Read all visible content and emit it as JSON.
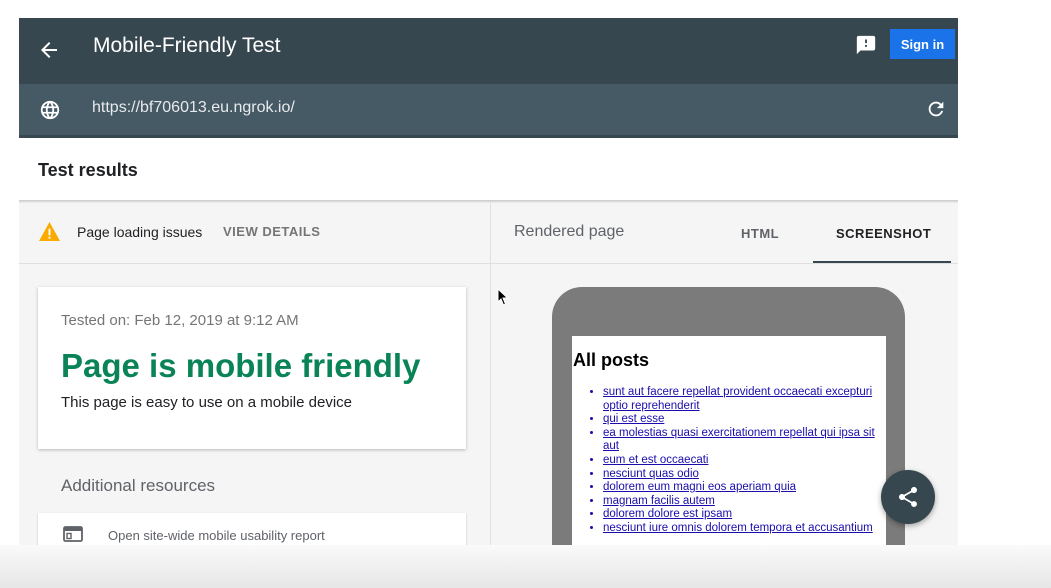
{
  "header": {
    "title": "Mobile-Friendly Test",
    "sign_in_label": "Sign in",
    "back_icon": "arrow-back-icon",
    "feedback_icon": "feedback-icon"
  },
  "url_bar": {
    "url": "https://bf706013.eu.ngrok.io/",
    "globe_icon": "globe-icon",
    "reload_icon": "reload-icon"
  },
  "results": {
    "heading": "Test results"
  },
  "issues": {
    "label": "Page loading issues",
    "view_details": "VIEW DETAILS",
    "icon": "warning-icon"
  },
  "verdict_card": {
    "tested_on": "Tested on: Feb 12, 2019 at 9:12 AM",
    "verdict": "Page is mobile friendly",
    "subtitle": "This page is easy to use on a mobile device"
  },
  "additional": {
    "heading": "Additional resources",
    "items": [
      {
        "label": "Open site-wide mobile usability report",
        "icon": "browser-window-icon"
      }
    ]
  },
  "right_panel": {
    "rendered_label": "Rendered page",
    "tabs": [
      {
        "label": "HTML",
        "selected": false
      },
      {
        "label": "SCREENSHOT",
        "selected": true
      }
    ]
  },
  "phone_preview": {
    "heading": "All posts",
    "posts": [
      "sunt aut facere repellat provident occaecati excepturi optio reprehenderit",
      "qui est esse",
      "ea molestias quasi exercitationem repellat qui ipsa sit aut",
      "eum et est occaecati",
      "nesciunt quas odio",
      "dolorem eum magni eos aperiam quia",
      "magnam facilis autem",
      "dolorem dolore est ipsam",
      "nesciunt iure omnis dolorem tempora et accusantium"
    ]
  },
  "fab": {
    "icon": "share-icon"
  },
  "colors": {
    "header_bg": "#37474f",
    "url_bar_bg": "#455a64",
    "sign_in_bg": "#1a73e8",
    "verdict_green": "#0a8457",
    "warning_amber": "#f9ab00",
    "link_blue": "#1a0dab"
  }
}
